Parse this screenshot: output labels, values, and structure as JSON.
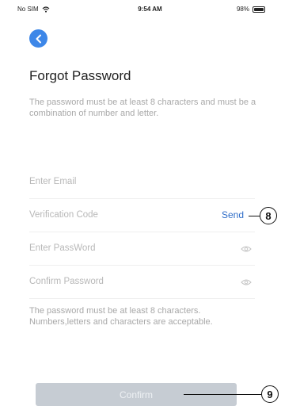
{
  "status_bar": {
    "carrier": "No SIM",
    "time": "9:54 AM",
    "battery": "98%"
  },
  "header": {
    "title": "Forgot Password"
  },
  "description": "The password must be at least 8 characters and must be a combination of number and letter.",
  "form": {
    "email_placeholder": "Enter Email",
    "code_placeholder": "Verification Code",
    "send_label": "Send",
    "password_placeholder": "Enter PassWord",
    "confirm_password_placeholder": "Confirm Password"
  },
  "hint": "The password must be at least 8 characters. Numbers,letters and characters are acceptable.",
  "confirm_label": "Confirm",
  "callouts": {
    "send": "8",
    "confirm": "9"
  },
  "colors": {
    "accent": "#2f6dc8",
    "back_button": "#3d87e8",
    "confirm_disabled": "#c6ccd3"
  }
}
